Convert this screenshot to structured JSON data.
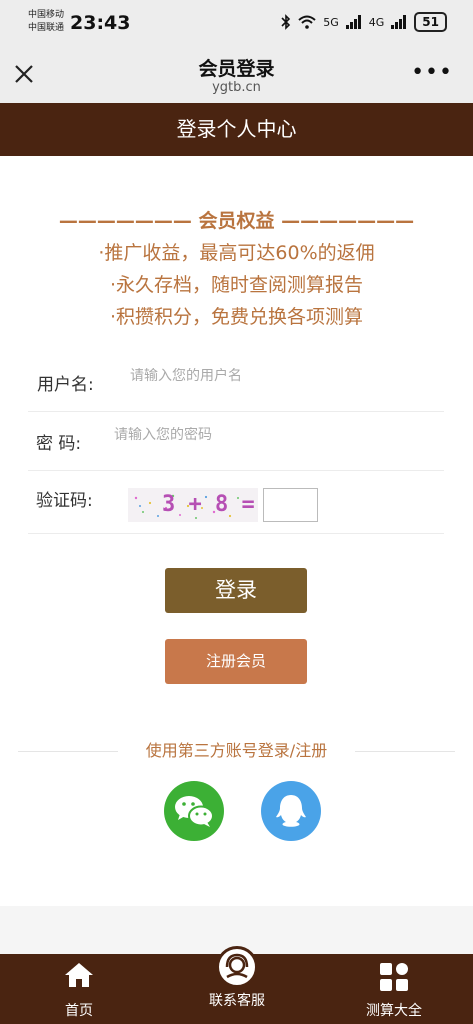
{
  "status_bar": {
    "carrier_1": "中国移动",
    "carrier_2": "中国联通",
    "time": "23:43",
    "network_1": "5G",
    "network_2": "4G",
    "battery": "51"
  },
  "nav": {
    "title": "会员登录",
    "subtitle": "ygtb.cn",
    "more": "•••"
  },
  "header": {
    "title": "登录个人中心"
  },
  "benefits": {
    "title": "——————— 会员权益 ———————",
    "items": [
      "·推广收益，最高可达60%的返佣",
      "·永久存档，随时查阅测算报告",
      "·积攒积分，免费兑换各项测算"
    ]
  },
  "form": {
    "username_label": "用户名:",
    "username_placeholder": "请输入您的用户名",
    "password_label": "密 码:",
    "password_placeholder": "请输入您的密码",
    "captcha_label": "验证码:",
    "captcha_text": "3 +  8 ="
  },
  "buttons": {
    "login": "登录",
    "register": "注册会员"
  },
  "third_party": {
    "title": "使用第三方账号登录/注册",
    "wechat_color": "#3cb035",
    "qq_color": "#4aa3e8"
  },
  "tab_bar": {
    "items": [
      {
        "label": "首页",
        "icon": "home-icon"
      },
      {
        "label": "联系客服",
        "icon": "customer-service-icon"
      },
      {
        "label": "测算大全",
        "icon": "grid-icon"
      }
    ]
  },
  "colors": {
    "brown_dark": "#4a2411",
    "accent_orange": "#b9743f",
    "login_button": "#7b5e2c",
    "register_button": "#c8784b"
  }
}
